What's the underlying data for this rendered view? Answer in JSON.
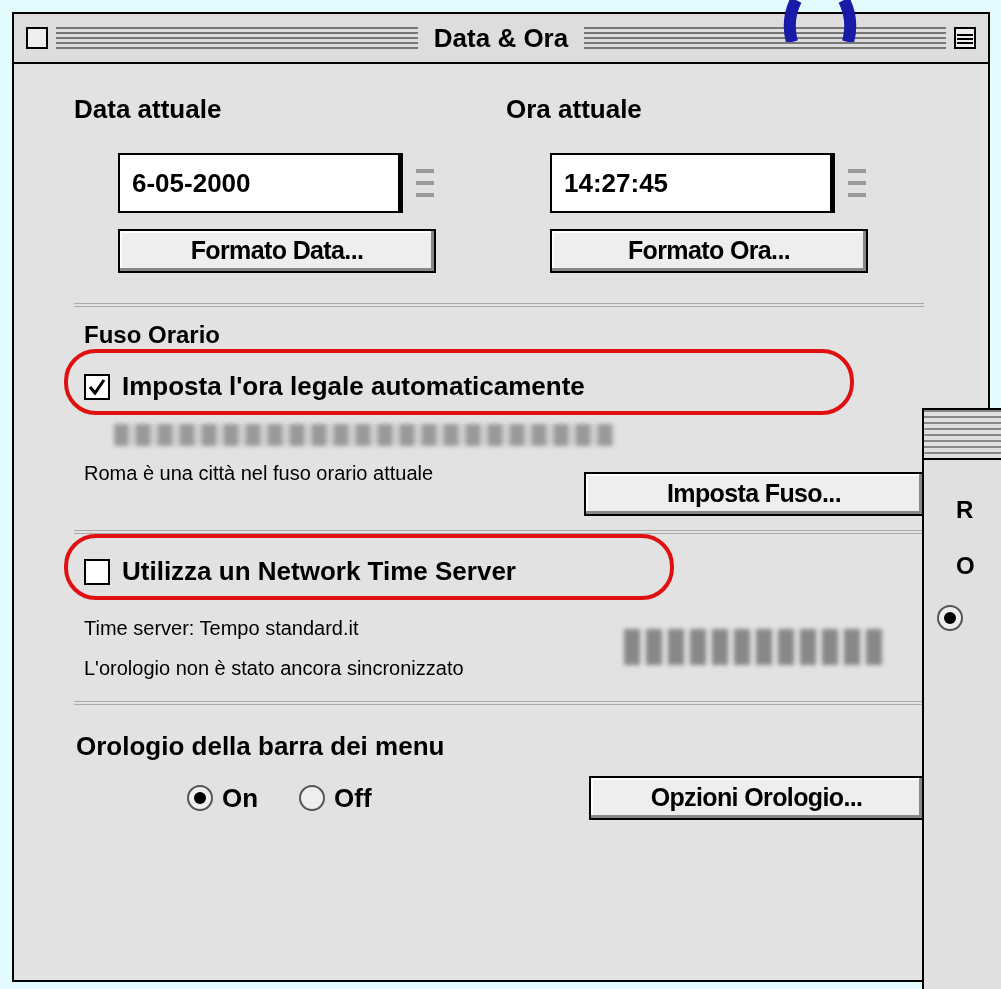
{
  "window": {
    "title": "Data & Ora"
  },
  "date": {
    "label": "Data attuale",
    "value": "6-05-2000",
    "button": "Formato Data..."
  },
  "time": {
    "label": "Ora attuale",
    "value": "14:27:45",
    "button": "Formato Ora..."
  },
  "time_zone": {
    "label": "Fuso Orario",
    "dst_checkbox": {
      "label": "Imposta l'ora legale automaticamente",
      "checked": true
    },
    "info": "Roma è una città nel fuso orario attuale",
    "button": "Imposta Fuso..."
  },
  "network_time": {
    "checkbox": {
      "label": "Utilizza un Network Time Server",
      "checked": false
    },
    "server": "Time server: Tempo standard.it",
    "info": "L'orologio non è stato ancora sincronizzato"
  },
  "menu_clock": {
    "label": "Orologio della barra dei menu",
    "options": [
      {
        "label": "On",
        "selected": true
      },
      {
        "label": "Off",
        "selected": false
      }
    ],
    "button": "Opzioni Orologio..."
  },
  "background_window": {
    "labels": [
      "R",
      "O"
    ],
    "radio": {
      "selected": true
    }
  }
}
